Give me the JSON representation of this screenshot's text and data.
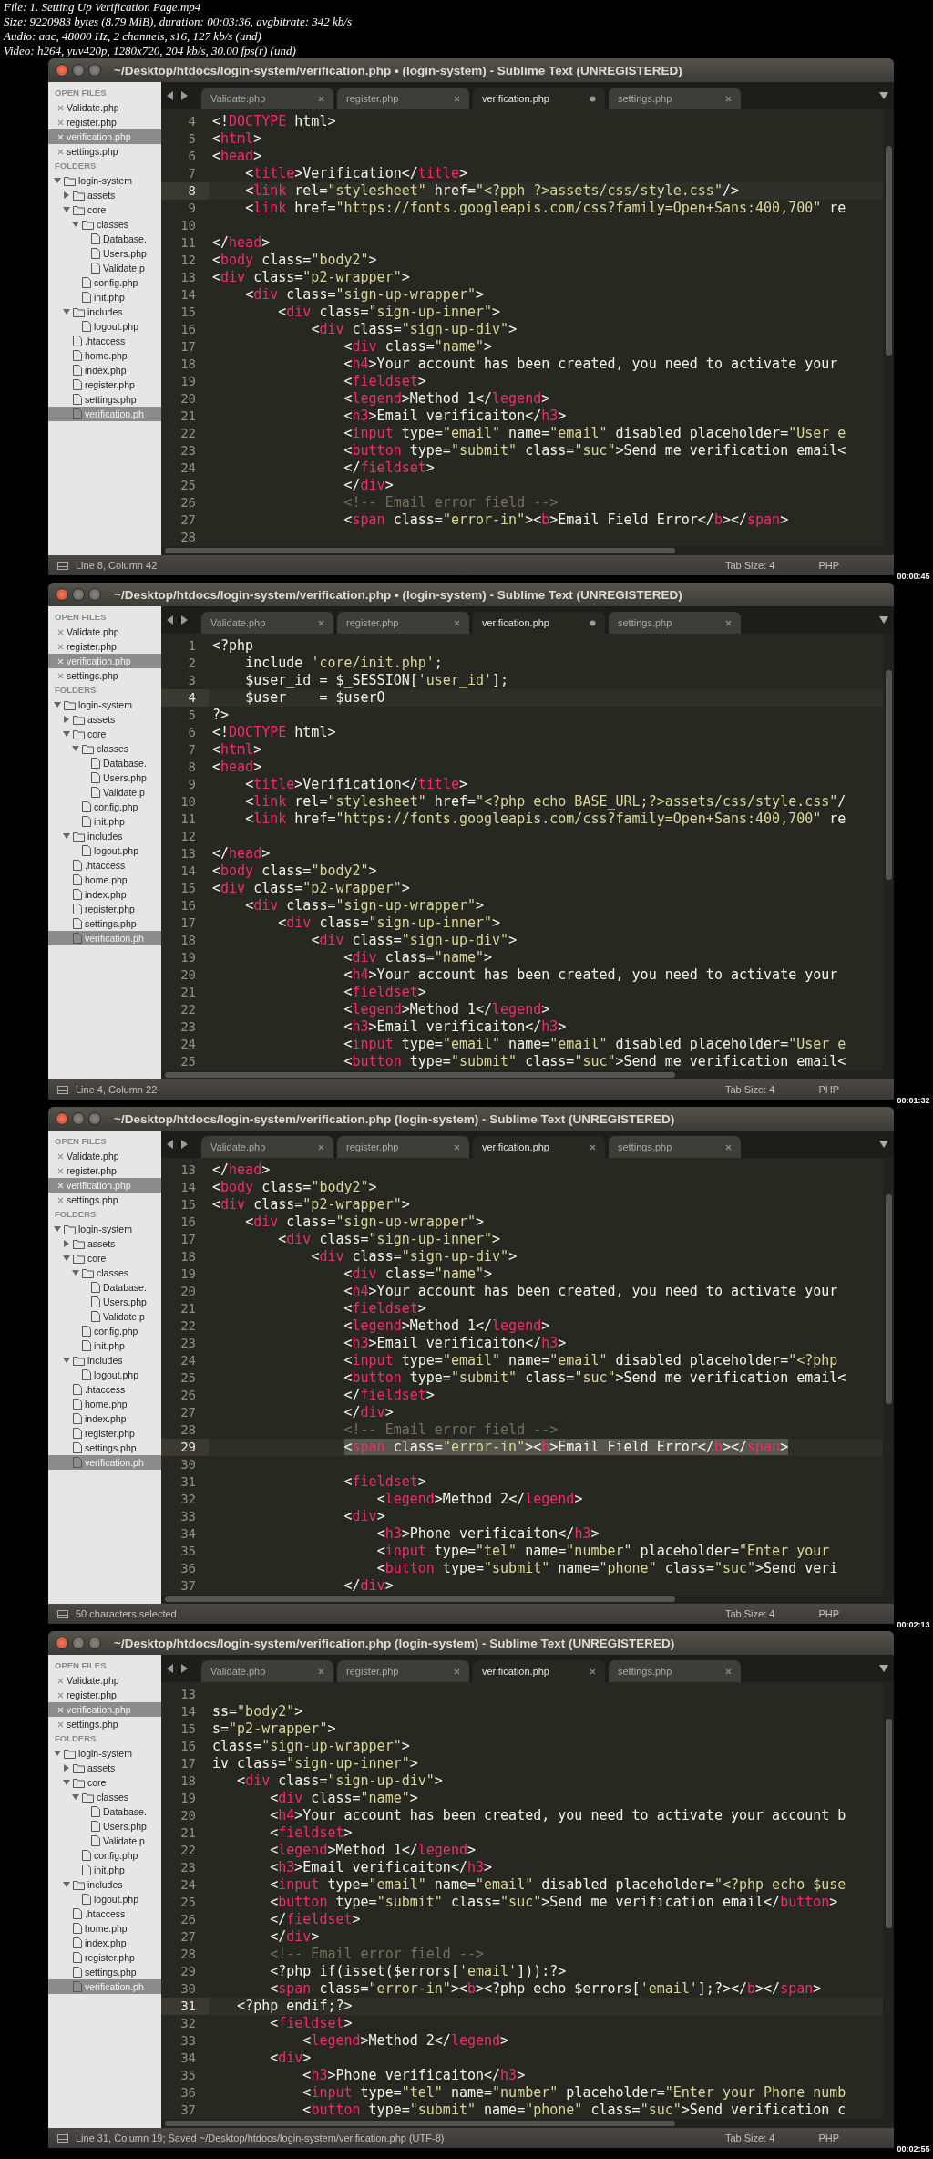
{
  "header": [
    "File: 1. Setting Up Verification Page.mp4",
    "Size: 9220983 bytes (8.79 MiB), duration: 00:03:36, avgbitrate: 342 kb/s",
    "Audio: aac, 48000 Hz, 2 channels, s16, 127 kb/s (und)",
    "Video: h264, yuv420p, 1280x720, 204 kb/s, 30.00 fps(r) (und)"
  ],
  "frames": [
    {
      "window": {
        "title": "~/Desktop/htdocs/login-system/verification.php • (login-system) - Sublime Text (UNREGISTERED)"
      },
      "sidebar": {
        "open_files_heading": "OPEN FILES",
        "open_files": [
          {
            "name": "Validate.php",
            "selected": false
          },
          {
            "name": "register.php",
            "selected": false
          },
          {
            "name": "verification.php",
            "selected": true
          },
          {
            "name": "settings.php",
            "selected": false
          }
        ],
        "folders_heading": "FOLDERS",
        "folders": [
          {
            "name": "login-system",
            "kind": "folder",
            "expanded": true,
            "selected": false,
            "children": [
              {
                "name": "assets",
                "kind": "folder",
                "expanded": false,
                "selected": false
              },
              {
                "name": "core",
                "kind": "folder",
                "expanded": true,
                "selected": false,
                "children": [
                  {
                    "name": "classes",
                    "kind": "folder",
                    "expanded": true,
                    "selected": false,
                    "children": [
                      {
                        "name": "Database.",
                        "kind": "file",
                        "selected": false
                      },
                      {
                        "name": "Users.php",
                        "kind": "file",
                        "selected": false
                      },
                      {
                        "name": "Validate.p",
                        "kind": "file",
                        "selected": false
                      }
                    ]
                  },
                  {
                    "name": "config.php",
                    "kind": "file",
                    "selected": false
                  },
                  {
                    "name": "init.php",
                    "kind": "file",
                    "selected": false
                  }
                ]
              },
              {
                "name": "includes",
                "kind": "folder",
                "expanded": true,
                "selected": false,
                "children": [
                  {
                    "name": "logout.php",
                    "kind": "file",
                    "selected": false
                  }
                ]
              },
              {
                "name": ".htaccess",
                "kind": "file",
                "selected": false
              },
              {
                "name": "home.php",
                "kind": "file",
                "selected": false
              },
              {
                "name": "index.php",
                "kind": "file",
                "selected": false
              },
              {
                "name": "register.php",
                "kind": "file",
                "selected": false
              },
              {
                "name": "settings.php",
                "kind": "file",
                "selected": false
              },
              {
                "name": "verification.ph",
                "kind": "file",
                "selected": true
              }
            ]
          }
        ]
      },
      "tabs": [
        {
          "label": "Validate.php",
          "selected": false,
          "modified": false
        },
        {
          "label": "register.php",
          "selected": false,
          "modified": false
        },
        {
          "label": "verification.php",
          "selected": true,
          "modified": true
        },
        {
          "label": "settings.php",
          "selected": false,
          "modified": false
        }
      ],
      "editor": {
        "lines": [
          {
            "number": "4",
            "text": "<!DOCTYPE html>",
            "current": false,
            "selection": false
          },
          {
            "number": "5",
            "text": "<html>",
            "current": false,
            "selection": false
          },
          {
            "number": "6",
            "text": "<head>",
            "current": false,
            "selection": false
          },
          {
            "number": "7",
            "text": "    <title>Verification</title>",
            "current": false,
            "selection": false
          },
          {
            "number": "8",
            "text": "    <link rel=\"stylesheet\" href=\"<?pph ?>assets/css/style.css\"/>",
            "current": true,
            "selection": false
          },
          {
            "number": "9",
            "text": "    <link href=\"https://fonts.googleapis.com/css?family=Open+Sans:400,700\" re",
            "current": false,
            "selection": false
          },
          {
            "number": "10",
            "current": false
          },
          {
            "number": "11",
            "text": "</head>",
            "current": false,
            "selection": false
          },
          {
            "number": "12",
            "text": "<body class=\"body2\">",
            "current": false,
            "selection": false
          },
          {
            "number": "13",
            "text": "<div class=\"p2-wrapper\">",
            "current": false,
            "selection": false
          },
          {
            "number": "14",
            "text": "    <div class=\"sign-up-wrapper\">",
            "current": false,
            "selection": false
          },
          {
            "number": "15",
            "text": "        <div class=\"sign-up-inner\">",
            "current": false,
            "selection": false
          },
          {
            "number": "16",
            "text": "            <div class=\"sign-up-div\">",
            "current": false,
            "selection": false
          },
          {
            "number": "17",
            "text": "                <div class=\"name\">",
            "current": false,
            "selection": false
          },
          {
            "number": "18",
            "text": "                <h4>Your account has been created, you need to activate your",
            "current": false,
            "selection": false
          },
          {
            "number": "19",
            "text": "                <fieldset>",
            "current": false,
            "selection": false
          },
          {
            "number": "20",
            "text": "                <legend>Method 1</legend>",
            "current": false,
            "selection": false
          },
          {
            "number": "21",
            "text": "                <h3>Email verificaiton</h3>",
            "current": false,
            "selection": false
          },
          {
            "number": "22",
            "text": "                <input type=\"email\" name=\"email\" disabled placeholder=\"User e",
            "current": false,
            "selection": false
          },
          {
            "number": "23",
            "text": "                <button type=\"submit\" class=\"suc\">Send me verification email<",
            "current": false,
            "selection": false
          },
          {
            "number": "24",
            "text": "                </fieldset>",
            "current": false,
            "selection": false
          },
          {
            "number": "25",
            "text": "                </div>",
            "current": false,
            "selection": false
          },
          {
            "number": "26",
            "text": "                <!-- Email error field -->",
            "current": false,
            "selection": false
          },
          {
            "number": "27",
            "text": "                <span class=\"error-in\"><b>Email Field Error</b></span>",
            "current": false,
            "selection": false
          },
          {
            "number": "28",
            "current": false
          }
        ]
      },
      "status_bar": {
        "position": "Line 8, Column 42",
        "tab_size": "Tab Size: 4",
        "syntax": "PHP"
      },
      "timestamp": "00:00:45"
    },
    {
      "window": {
        "title": "~/Desktop/htdocs/login-system/verification.php • (login-system) - Sublime Text (UNREGISTERED)"
      },
      "sidebar": {
        "open_files_heading": "OPEN FILES",
        "open_files": [
          {
            "name": "Validate.php",
            "selected": false
          },
          {
            "name": "register.php",
            "selected": false
          },
          {
            "name": "verification.php",
            "selected": true
          },
          {
            "name": "settings.php",
            "selected": false
          }
        ],
        "folders_heading": "FOLDERS",
        "folders": [
          {
            "name": "login-system",
            "kind": "folder",
            "expanded": true,
            "selected": false,
            "children": [
              {
                "name": "assets",
                "kind": "folder",
                "expanded": false,
                "selected": false
              },
              {
                "name": "core",
                "kind": "folder",
                "expanded": true,
                "selected": false,
                "children": [
                  {
                    "name": "classes",
                    "kind": "folder",
                    "expanded": true,
                    "selected": false,
                    "children": [
                      {
                        "name": "Database.",
                        "kind": "file",
                        "selected": false
                      },
                      {
                        "name": "Users.php",
                        "kind": "file",
                        "selected": false
                      },
                      {
                        "name": "Validate.p",
                        "kind": "file",
                        "selected": false
                      }
                    ]
                  },
                  {
                    "name": "config.php",
                    "kind": "file",
                    "selected": false
                  },
                  {
                    "name": "init.php",
                    "kind": "file",
                    "selected": false
                  }
                ]
              },
              {
                "name": "includes",
                "kind": "folder",
                "expanded": true,
                "selected": false,
                "children": [
                  {
                    "name": "logout.php",
                    "kind": "file",
                    "selected": false
                  }
                ]
              },
              {
                "name": ".htaccess",
                "kind": "file",
                "selected": false
              },
              {
                "name": "home.php",
                "kind": "file",
                "selected": false
              },
              {
                "name": "index.php",
                "kind": "file",
                "selected": false
              },
              {
                "name": "register.php",
                "kind": "file",
                "selected": false
              },
              {
                "name": "settings.php",
                "kind": "file",
                "selected": false
              },
              {
                "name": "verification.ph",
                "kind": "file",
                "selected": true
              }
            ]
          }
        ]
      },
      "tabs": [
        {
          "label": "Validate.php",
          "selected": false,
          "modified": false
        },
        {
          "label": "register.php",
          "selected": false,
          "modified": false
        },
        {
          "label": "verification.php",
          "selected": true,
          "modified": true
        },
        {
          "label": "settings.php",
          "selected": false,
          "modified": false
        }
      ],
      "editor": {
        "lines": [
          {
            "number": "1",
            "text": "<?php",
            "current": false,
            "selection": false
          },
          {
            "number": "2",
            "text": "    include 'core/init.php';",
            "current": false,
            "selection": false
          },
          {
            "number": "3",
            "text": "    $user_id = $_SESSION['user_id'];",
            "current": false,
            "selection": false
          },
          {
            "number": "4",
            "text": "    $user    = $userO",
            "current": true,
            "selection": false
          },
          {
            "number": "5",
            "text": "?>",
            "current": false,
            "selection": false
          },
          {
            "number": "6",
            "text": "<!DOCTYPE html>",
            "current": false,
            "selection": false
          },
          {
            "number": "7",
            "text": "<html>",
            "current": false,
            "selection": false
          },
          {
            "number": "8",
            "text": "<head>",
            "current": false,
            "selection": false
          },
          {
            "number": "9",
            "text": "    <title>Verification</title>",
            "current": false,
            "selection": false
          },
          {
            "number": "10",
            "text": "    <link rel=\"stylesheet\" href=\"<?php echo BASE_URL;?>assets/css/style.css\"/",
            "current": false,
            "selection": false
          },
          {
            "number": "11",
            "text": "    <link href=\"https://fonts.googleapis.com/css?family=Open+Sans:400,700\" re",
            "current": false,
            "selection": false
          },
          {
            "number": "12",
            "current": false
          },
          {
            "number": "13",
            "text": "</head>",
            "current": false,
            "selection": false
          },
          {
            "number": "14",
            "text": "<body class=\"body2\">",
            "current": false,
            "selection": false
          },
          {
            "number": "15",
            "text": "<div class=\"p2-wrapper\">",
            "current": false,
            "selection": false
          },
          {
            "number": "16",
            "text": "    <div class=\"sign-up-wrapper\">",
            "current": false,
            "selection": false
          },
          {
            "number": "17",
            "text": "        <div class=\"sign-up-inner\">",
            "current": false,
            "selection": false
          },
          {
            "number": "18",
            "text": "            <div class=\"sign-up-div\">",
            "current": false,
            "selection": false
          },
          {
            "number": "19",
            "text": "                <div class=\"name\">",
            "current": false,
            "selection": false
          },
          {
            "number": "20",
            "text": "                <h4>Your account has been created, you need to activate your",
            "current": false,
            "selection": false
          },
          {
            "number": "21",
            "text": "                <fieldset>",
            "current": false,
            "selection": false
          },
          {
            "number": "22",
            "text": "                <legend>Method 1</legend>",
            "current": false,
            "selection": false
          },
          {
            "number": "23",
            "text": "                <h3>Email verificaiton</h3>",
            "current": false,
            "selection": false
          },
          {
            "number": "24",
            "text": "                <input type=\"email\" name=\"email\" disabled placeholder=\"User e",
            "current": false,
            "selection": false
          },
          {
            "number": "25",
            "text": "                <button type=\"submit\" class=\"suc\">Send me verification email<",
            "current": false,
            "selection": false
          }
        ]
      },
      "status_bar": {
        "position": "Line 4, Column 22",
        "tab_size": "Tab Size: 4",
        "syntax": "PHP"
      },
      "timestamp": "00:01:32"
    },
    {
      "window": {
        "title": "~/Desktop/htdocs/login-system/verification.php (login-system) - Sublime Text (UNREGISTERED)"
      },
      "sidebar": {
        "open_files_heading": "OPEN FILES",
        "open_files": [
          {
            "name": "Validate.php",
            "selected": false
          },
          {
            "name": "register.php",
            "selected": false
          },
          {
            "name": "verification.php",
            "selected": true
          },
          {
            "name": "settings.php",
            "selected": false
          }
        ],
        "folders_heading": "FOLDERS",
        "folders": [
          {
            "name": "login-system",
            "kind": "folder",
            "expanded": true,
            "selected": false,
            "children": [
              {
                "name": "assets",
                "kind": "folder",
                "expanded": false,
                "selected": false
              },
              {
                "name": "core",
                "kind": "folder",
                "expanded": true,
                "selected": false,
                "children": [
                  {
                    "name": "classes",
                    "kind": "folder",
                    "expanded": true,
                    "selected": false,
                    "children": [
                      {
                        "name": "Database.",
                        "kind": "file",
                        "selected": false
                      },
                      {
                        "name": "Users.php",
                        "kind": "file",
                        "selected": false
                      },
                      {
                        "name": "Validate.p",
                        "kind": "file",
                        "selected": false
                      }
                    ]
                  },
                  {
                    "name": "config.php",
                    "kind": "file",
                    "selected": false
                  },
                  {
                    "name": "init.php",
                    "kind": "file",
                    "selected": false
                  }
                ]
              },
              {
                "name": "includes",
                "kind": "folder",
                "expanded": true,
                "selected": false,
                "children": [
                  {
                    "name": "logout.php",
                    "kind": "file",
                    "selected": false
                  }
                ]
              },
              {
                "name": ".htaccess",
                "kind": "file",
                "selected": false
              },
              {
                "name": "home.php",
                "kind": "file",
                "selected": false
              },
              {
                "name": "index.php",
                "kind": "file",
                "selected": false
              },
              {
                "name": "register.php",
                "kind": "file",
                "selected": false
              },
              {
                "name": "settings.php",
                "kind": "file",
                "selected": false
              },
              {
                "name": "verification.ph",
                "kind": "file",
                "selected": true
              }
            ]
          }
        ]
      },
      "tabs": [
        {
          "label": "Validate.php",
          "selected": false,
          "modified": false
        },
        {
          "label": "register.php",
          "selected": false,
          "modified": false
        },
        {
          "label": "verification.php",
          "selected": true,
          "modified": false
        },
        {
          "label": "settings.php",
          "selected": false,
          "modified": false
        }
      ],
      "editor": {
        "lines": [
          {
            "number": "13",
            "text": "</head>",
            "current": false,
            "selection": false
          },
          {
            "number": "14",
            "text": "<body class=\"body2\">",
            "current": false,
            "selection": false
          },
          {
            "number": "15",
            "text": "<div class=\"p2-wrapper\">",
            "current": false,
            "selection": false
          },
          {
            "number": "16",
            "text": "    <div class=\"sign-up-wrapper\">",
            "current": false,
            "selection": false
          },
          {
            "number": "17",
            "text": "        <div class=\"sign-up-inner\">",
            "current": false,
            "selection": false
          },
          {
            "number": "18",
            "text": "            <div class=\"sign-up-div\">",
            "current": false,
            "selection": false
          },
          {
            "number": "19",
            "text": "                <div class=\"name\">",
            "current": false,
            "selection": false
          },
          {
            "number": "20",
            "text": "                <h4>Your account has been created, you need to activate your",
            "current": false,
            "selection": false
          },
          {
            "number": "21",
            "text": "                <fieldset>",
            "current": false,
            "selection": false
          },
          {
            "number": "22",
            "text": "                <legend>Method 1</legend>",
            "current": false,
            "selection": false
          },
          {
            "number": "23",
            "text": "                <h3>Email verificaiton</h3>",
            "current": false,
            "selection": false
          },
          {
            "number": "24",
            "text": "                <input type=\"email\" name=\"email\" disabled placeholder=\"<?php",
            "current": false,
            "selection": false
          },
          {
            "number": "25",
            "text": "                <button type=\"submit\" class=\"suc\">Send me verification email<",
            "current": false,
            "selection": false
          },
          {
            "number": "26",
            "text": "                </fieldset>",
            "current": false,
            "selection": false
          },
          {
            "number": "27",
            "text": "                </div>",
            "current": false,
            "selection": false
          },
          {
            "number": "28",
            "text": "                <!-- Email error field -->",
            "current": false,
            "selection": false
          },
          {
            "number": "29",
            "text": "                <span class=\"error-in\"><b>Email Field Error</b></span>",
            "current": true,
            "selection": true
          },
          {
            "number": "30",
            "current": false
          },
          {
            "number": "31",
            "text": "                <fieldset>",
            "current": false,
            "selection": false
          },
          {
            "number": "32",
            "text": "                    <legend>Method 2</legend>",
            "current": false,
            "selection": false
          },
          {
            "number": "33",
            "text": "                <div>",
            "current": false,
            "selection": false
          },
          {
            "number": "34",
            "text": "                    <h3>Phone verificaiton</h3>",
            "current": false,
            "selection": false
          },
          {
            "number": "35",
            "text": "                    <input type=\"tel\" name=\"number\" placeholder=\"Enter your",
            "current": false,
            "selection": false
          },
          {
            "number": "36",
            "text": "                    <button type=\"submit\" name=\"phone\" class=\"suc\">Send veri",
            "current": false,
            "selection": false
          },
          {
            "number": "37",
            "text": "                </div>",
            "current": false,
            "selection": false
          }
        ]
      },
      "status_bar": {
        "position": "50 characters selected",
        "tab_size": "Tab Size: 4",
        "syntax": "PHP"
      },
      "timestamp": "00:02:13"
    },
    {
      "window": {
        "title": "~/Desktop/htdocs/login-system/verification.php (login-system) - Sublime Text (UNREGISTERED)"
      },
      "sidebar": {
        "open_files_heading": "OPEN FILES",
        "open_files": [
          {
            "name": "Validate.php",
            "selected": false
          },
          {
            "name": "register.php",
            "selected": false
          },
          {
            "name": "verification.php",
            "selected": true
          },
          {
            "name": "settings.php",
            "selected": false
          }
        ],
        "folders_heading": "FOLDERS",
        "folders": [
          {
            "name": "login-system",
            "kind": "folder",
            "expanded": true,
            "selected": false,
            "children": [
              {
                "name": "assets",
                "kind": "folder",
                "expanded": false,
                "selected": false
              },
              {
                "name": "core",
                "kind": "folder",
                "expanded": true,
                "selected": false,
                "children": [
                  {
                    "name": "classes",
                    "kind": "folder",
                    "expanded": true,
                    "selected": false,
                    "children": [
                      {
                        "name": "Database.",
                        "kind": "file",
                        "selected": false
                      },
                      {
                        "name": "Users.php",
                        "kind": "file",
                        "selected": false
                      },
                      {
                        "name": "Validate.p",
                        "kind": "file",
                        "selected": false
                      }
                    ]
                  },
                  {
                    "name": "config.php",
                    "kind": "file",
                    "selected": false
                  },
                  {
                    "name": "init.php",
                    "kind": "file",
                    "selected": false
                  }
                ]
              },
              {
                "name": "includes",
                "kind": "folder",
                "expanded": true,
                "selected": false,
                "children": [
                  {
                    "name": "logout.php",
                    "kind": "file",
                    "selected": false
                  }
                ]
              },
              {
                "name": ".htaccess",
                "kind": "file",
                "selected": false
              },
              {
                "name": "home.php",
                "kind": "file",
                "selected": false
              },
              {
                "name": "index.php",
                "kind": "file",
                "selected": false
              },
              {
                "name": "register.php",
                "kind": "file",
                "selected": false
              },
              {
                "name": "settings.php",
                "kind": "file",
                "selected": false
              },
              {
                "name": "verification.ph",
                "kind": "file",
                "selected": true
              }
            ]
          }
        ]
      },
      "tabs": [
        {
          "label": "Validate.php",
          "selected": false,
          "modified": false
        },
        {
          "label": "register.php",
          "selected": false,
          "modified": false
        },
        {
          "label": "verification.php",
          "selected": true,
          "modified": false
        },
        {
          "label": "settings.php",
          "selected": false,
          "modified": false
        }
      ],
      "editor": {
        "lines": [
          {
            "number": "13",
            "current": false
          },
          {
            "number": "14",
            "text": "ss=\"body2\">",
            "current": false,
            "selection": false
          },
          {
            "number": "15",
            "text": "s=\"p2-wrapper\">",
            "current": false,
            "selection": false
          },
          {
            "number": "16",
            "text": "class=\"sign-up-wrapper\">",
            "current": false,
            "selection": false
          },
          {
            "number": "17",
            "text": "iv class=\"sign-up-inner\">",
            "current": false,
            "selection": false
          },
          {
            "number": "18",
            "text": "   <div class=\"sign-up-div\">",
            "current": false,
            "selection": false
          },
          {
            "number": "19",
            "text": "       <div class=\"name\">",
            "current": false,
            "selection": false
          },
          {
            "number": "20",
            "text": "       <h4>Your account has been created, you need to activate your account b",
            "current": false,
            "selection": false
          },
          {
            "number": "21",
            "text": "       <fieldset>",
            "current": false,
            "selection": false
          },
          {
            "number": "22",
            "text": "       <legend>Method 1</legend>",
            "current": false,
            "selection": false
          },
          {
            "number": "23",
            "text": "       <h3>Email verificaiton</h3>",
            "current": false,
            "selection": false
          },
          {
            "number": "24",
            "text": "       <input type=\"email\" name=\"email\" disabled placeholder=\"<?php echo $use",
            "current": false,
            "selection": false
          },
          {
            "number": "25",
            "text": "       <button type=\"submit\" class=\"suc\">Send me verification email</button>",
            "current": false,
            "selection": false
          },
          {
            "number": "26",
            "text": "       </fieldset>",
            "current": false,
            "selection": false
          },
          {
            "number": "27",
            "text": "       </div>",
            "current": false,
            "selection": false
          },
          {
            "number": "28",
            "text": "       <!-- Email error field -->",
            "current": false,
            "selection": false
          },
          {
            "number": "29",
            "text": "       <?php if(isset($errors['email'])):?>",
            "current": false,
            "selection": false
          },
          {
            "number": "30",
            "text": "       <span class=\"error-in\"><b><?php echo $errors['email'];?></b></span>",
            "current": false,
            "selection": false
          },
          {
            "number": "31",
            "text": "   <?php endif;?>",
            "current": true,
            "selection": false
          },
          {
            "number": "32",
            "text": "       <fieldset>",
            "current": false,
            "selection": false
          },
          {
            "number": "33",
            "text": "           <legend>Method 2</legend>",
            "current": false,
            "selection": false
          },
          {
            "number": "34",
            "text": "       <div>",
            "current": false,
            "selection": false
          },
          {
            "number": "35",
            "text": "           <h3>Phone verificaiton</h3>",
            "current": false,
            "selection": false
          },
          {
            "number": "36",
            "text": "           <input type=\"tel\" name=\"number\" placeholder=\"Enter your Phone numb",
            "current": false,
            "selection": false
          },
          {
            "number": "37",
            "text": "           <button type=\"submit\" name=\"phone\" class=\"suc\">Send verification c",
            "current": false,
            "selection": false
          }
        ]
      },
      "status_bar": {
        "position": "Line 31, Column 19; Saved ~/Desktop/htdocs/login-system/verification.php (UTF-8)",
        "tab_size": "Tab Size: 4",
        "syntax": "PHP"
      },
      "timestamp": "00:02:55"
    }
  ]
}
